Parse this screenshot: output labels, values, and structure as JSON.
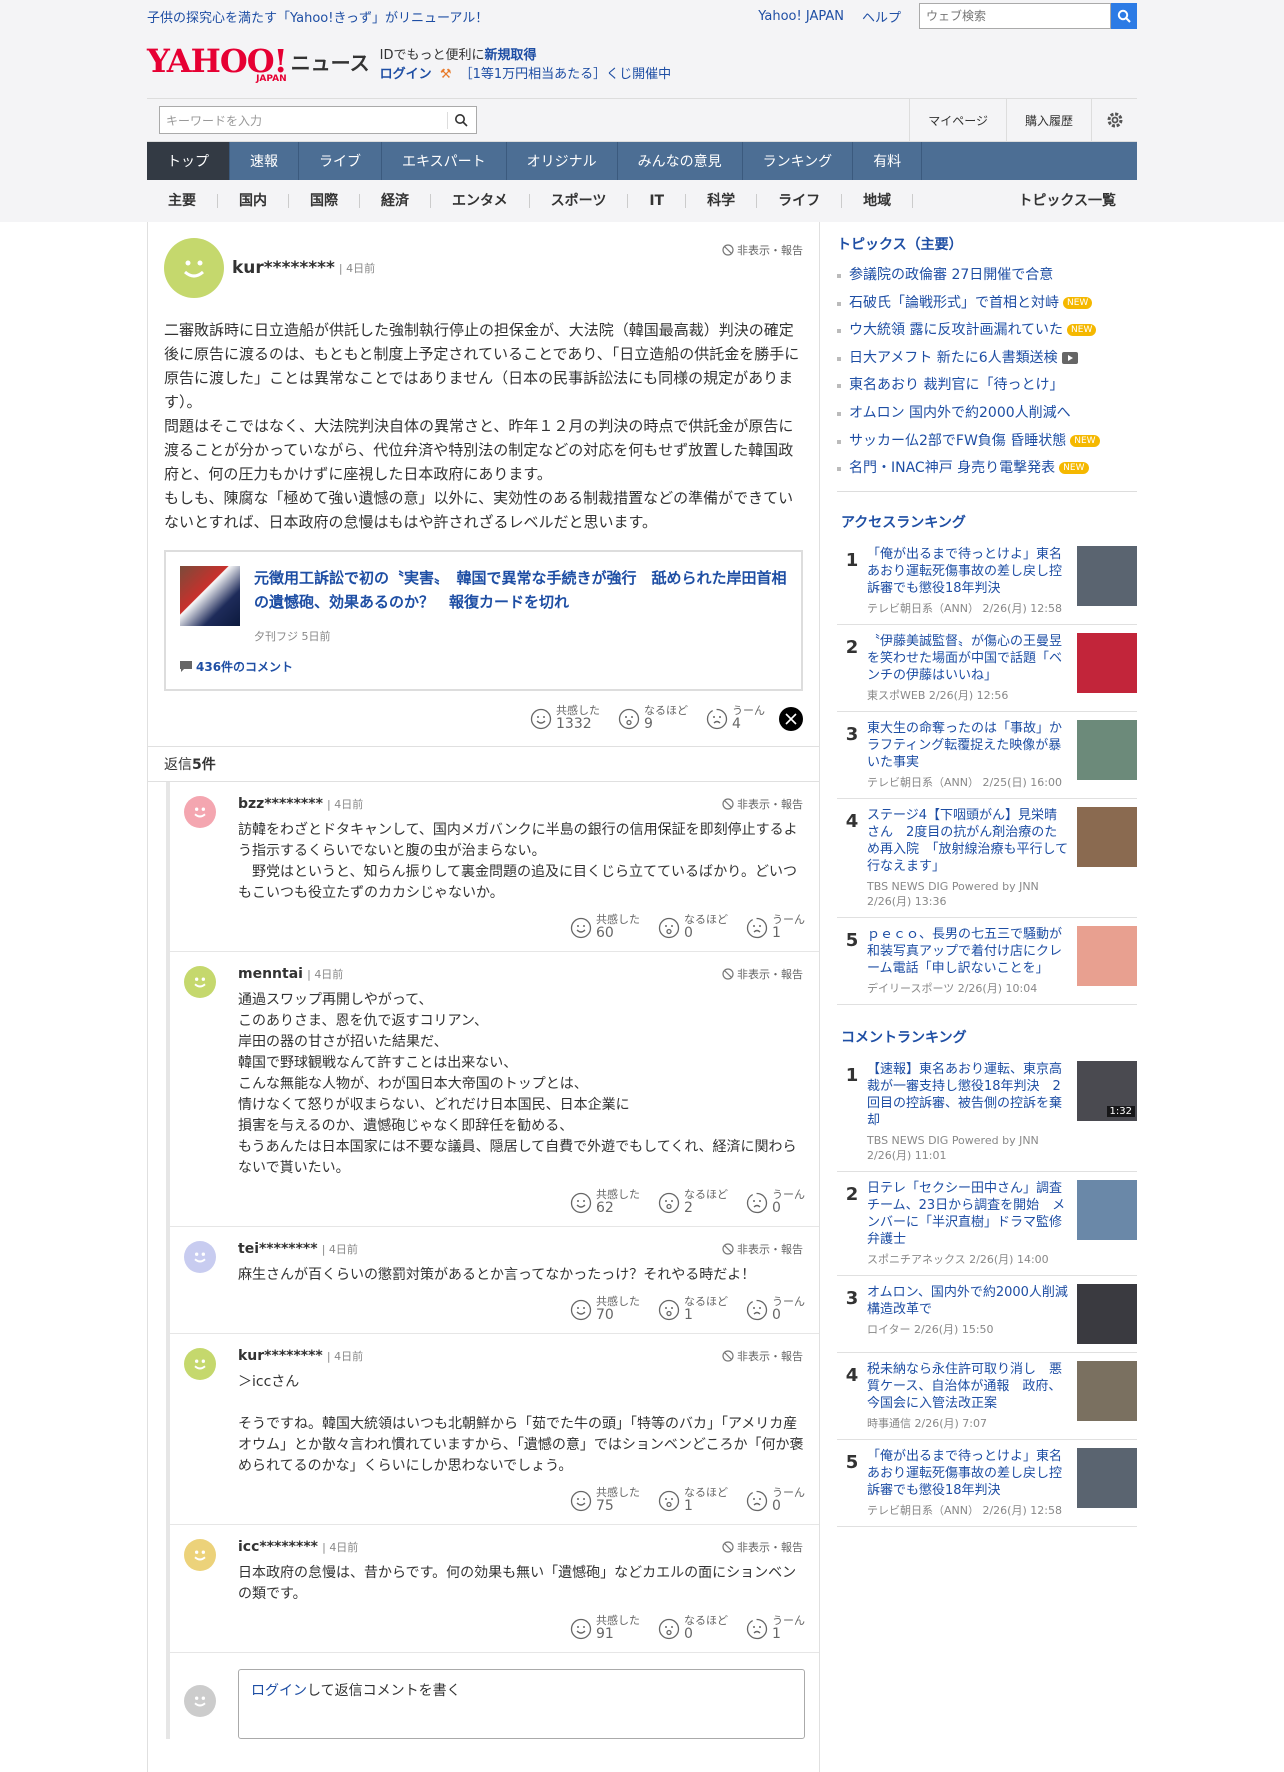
{
  "topbar": {
    "promo": "子供の探究心を満たす「Yahoo!きっず」がリニューアル！",
    "yahoo_japan": "Yahoo! JAPAN",
    "help": "ヘルプ",
    "search_placeholder": "ウェブ検索"
  },
  "header": {
    "logo_text": "YAHOO!",
    "logo_sub": "JAPAN",
    "service": "ニュース",
    "id_prefix": "IDでもっと便利に",
    "id_link": "新規取得",
    "login": "ログイン",
    "lottery": "［1等1万円相当あたる］くじ開催中"
  },
  "searchbar": {
    "placeholder": "キーワードを入力",
    "mypage": "マイページ",
    "history": "購入履歴"
  },
  "gnav": [
    "トップ",
    "速報",
    "ライブ",
    "エキスパート",
    "オリジナル",
    "みんなの意見",
    "ランキング",
    "有料"
  ],
  "subnav": [
    "主要",
    "国内",
    "国際",
    "経済",
    "エンタメ",
    "スポーツ",
    "IT",
    "科学",
    "ライフ",
    "地域"
  ],
  "subnav_all": "トピックス一覧",
  "main_comment": {
    "user": "kur********",
    "ago": "4日前",
    "hide": "非表示・報告",
    "text": "二審敗訴時に日立造船が供託した強制執行停止の担保金が、大法院（韓国最高裁）判決の確定後に原告に渡るのは、もともと制度上予定されていることであり、「日立造船の供託金を勝手に原告に渡した」ことは異常なことではありません（日本の民事訴訟法にも同様の規定があります）。\n問題はそこではなく、大法院判決自体の異常さと、昨年１２月の判決の時点で供託金が原告に渡ることが分かっていながら、代位弁済や特別法の制定などの対応を何もせず放置した韓国政府と、何の圧力もかけずに座視した日本政府にあります。\nもしも、陳腐な「極めて強い遺憾の意」以外に、実効性のある制裁措置などの準備ができていないとすれば、日本政府の怠慢はもはや許されざるレベルだと思います。",
    "article_title": "元徴用工訴訟で初の〝実害〟　韓国で異常な手続きが強行　舐められた岸田首相の遺憾砲、効果あるのか？　報復カードを切れ",
    "article_meta": "夕刊フジ 5日前",
    "comment_count": "436件のコメント",
    "reactions": {
      "agree_label": "共感した",
      "agree": "1332",
      "naruhodo_label": "なるほど",
      "naruhodo": "9",
      "uun_label": "うーん",
      "uun": "4"
    }
  },
  "reply_header": {
    "prefix": "返信",
    "count": "5件"
  },
  "replies": [
    {
      "user": "bzz********",
      "ago": "4日前",
      "hide": "非表示・報告",
      "color": "#f4a6b0",
      "text": "訪韓をわざとドタキャンして、国内メガバンクに半島の銀行の信用保証を即刻停止するよう指示するくらいでないと腹の虫が治まらない。\n　野党はというと、知らん振りして裏金問題の追及に目くじら立てているばかり。どいつもこいつも役立たずのカカシじゃないか。",
      "agree": "60",
      "naruhodo": "0",
      "uun": "1"
    },
    {
      "user": "menntai",
      "ago": "4日前",
      "hide": "非表示・報告",
      "color": "#c5d86d",
      "text": "通過スワップ再開しやがって、\nこのありさま、恩を仇で返すコリアン、\n岸田の器の甘さが招いた結果だ、\n韓国で野球観戦なんて許すことは出来ない、\nこんな無能な人物が、わが国日本大帝国のトップとは、\n情けなくて怒りが収まらない、どれだけ日本国民、日本企業に\n損害を与えるのか、遺憾砲じゃなく即辞任を勧める、\nもうあんたは日本国家には不要な議員、隠居して自費で外遊でもしてくれ、経済に関わらないで貰いたい。",
      "agree": "62",
      "naruhodo": "2",
      "uun": "0"
    },
    {
      "user": "tei********",
      "ago": "4日前",
      "hide": "非表示・報告",
      "color": "#c8ccf0",
      "text": "麻生さんが百くらいの懲罰対策があるとか言ってなかったっけ？それやる時だよ！",
      "agree": "70",
      "naruhodo": "1",
      "uun": "0"
    },
    {
      "user": "kur********",
      "ago": "4日前",
      "hide": "非表示・報告",
      "color": "#c5d86d",
      "text": "＞iccさん\n\nそうですね。韓国大統領はいつも北朝鮮から「茹でた牛の頭」「特等のバカ」「アメリカ産オウム」とか散々言われ慣れていますから、「遺憾の意」ではションベンどころか「何か褒められてるのかな」くらいにしか思わないでしょう。",
      "agree": "75",
      "naruhodo": "1",
      "uun": "0"
    },
    {
      "user": "icc********",
      "ago": "4日前",
      "hide": "非表示・報告",
      "color": "#ecd27a",
      "text": "日本政府の怠慢は、昔からです。何の効果も無い「遺憾砲」などカエルの面にションベンの類です。",
      "agree": "91",
      "naruhodo": "0",
      "uun": "1"
    }
  ],
  "reply_labels": {
    "agree": "共感した",
    "naruhodo": "なるほど",
    "uun": "うーん"
  },
  "reply_login": {
    "link": "ログイン",
    "rest": "して返信コメントを書く"
  },
  "sidebar": {
    "topics_title": "トピックス（主要）",
    "topics": [
      {
        "text": "参議院の政倫審 27日開催で合意",
        "badge": ""
      },
      {
        "text": "石破氏「論戦形式」で首相と対峙",
        "badge": "NEW"
      },
      {
        "text": "ウ大統領 露に反攻計画漏れていた",
        "badge": "NEW"
      },
      {
        "text": "日大アメフト 新たに6人書類送検",
        "badge": "video"
      },
      {
        "text": "東名あおり 裁判官に「待っとけ」",
        "badge": ""
      },
      {
        "text": "オムロン 国内外で約2000人削減へ",
        "badge": ""
      },
      {
        "text": "サッカー仏2部でFW負傷 昏睡状態",
        "badge": "NEW"
      },
      {
        "text": "名門・INAC神戸 身売り電撃発表",
        "badge": "NEW"
      }
    ],
    "access_title": "アクセスランキング",
    "access": [
      {
        "n": "1",
        "title": "「俺が出るまで待っとけよ」東名あおり運転死傷事故の差し戻し控訴審でも懲役18年判決",
        "meta": "テレビ朝日系（ANN） 2/26(月) 12:58",
        "color": "#5a6470"
      },
      {
        "n": "2",
        "title": "〝伊藤美誠監督〟が傷心の王曼昱を笑わせた場面が中国で話題「ベンチの伊藤はいいね」",
        "meta": "東スポWEB 2/26(月) 12:56",
        "color": "#c2253a"
      },
      {
        "n": "3",
        "title": "東大生の命奪ったのは「事故」かラフティング転覆捉えた映像が暴いた事実",
        "meta": "テレビ朝日系（ANN） 2/25(日) 16:00",
        "color": "#6c8a7a"
      },
      {
        "n": "4",
        "title": "ステージ4【下咽頭がん】見栄晴さん　2度目の抗がん剤治療のため再入院　「放射線治療も平行して行なえます」",
        "meta": "TBS NEWS DIG Powered by JNN 2/26(月) 13:36",
        "color": "#8a6a50"
      },
      {
        "n": "5",
        "title": "ｐｅｃｏ、長男の七五三で騒動が和装写真アップで着付け店にクレーム電話「申し訳ないことを」",
        "meta": "デイリースポーツ 2/26(月) 10:04",
        "color": "#e8a090"
      }
    ],
    "comment_title": "コメントランキング",
    "comment": [
      {
        "n": "1",
        "title": "【速報】東名あおり運転、東京高裁が一審支持し懲役18年判決　2回目の控訴審、被告側の控訴を棄却",
        "meta": "TBS NEWS DIG Powered by JNN 2/26(月) 11:01",
        "color": "#4a4a50",
        "dur": "1:32"
      },
      {
        "n": "2",
        "title": "日テレ「セクシー田中さん」調査チーム、23日から調査を開始　メンバーに「半沢直樹」ドラマ監修弁護士",
        "meta": "スポニチアネックス 2/26(月) 14:00",
        "color": "#6a88a8",
        "dur": ""
      },
      {
        "n": "3",
        "title": "オムロン、国内外で約2000人削減 構造改革で",
        "meta": "ロイター 2/26(月) 15:50",
        "color": "#3a3a40",
        "dur": ""
      },
      {
        "n": "4",
        "title": "税未納なら永住許可取り消し　悪質ケース、自治体が通報　政府、今国会に入管法改正案",
        "meta": "時事通信 2/26(月) 7:07",
        "color": "#7a7060",
        "dur": ""
      },
      {
        "n": "5",
        "title": "「俺が出るまで待っとけよ」東名あおり運転死傷事故の差し戻し控訴審でも懲役18年判決",
        "meta": "テレビ朝日系（ANN） 2/26(月) 12:58",
        "color": "#5a6470",
        "dur": ""
      }
    ]
  }
}
